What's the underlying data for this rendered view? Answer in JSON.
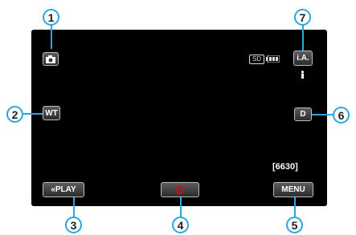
{
  "callouts": [
    "1",
    "2",
    "3",
    "4",
    "5",
    "6",
    "7"
  ],
  "status": {
    "card": "SD"
  },
  "buttons": {
    "wt": "WT",
    "play": "«PLAY",
    "menu": "MENU",
    "d": "D",
    "ia": "i.A."
  },
  "remaining_shots": "[6630]",
  "colors": {
    "callout_blue": "#27a8e0",
    "record_red": "#e60012",
    "screen": "#000000"
  }
}
